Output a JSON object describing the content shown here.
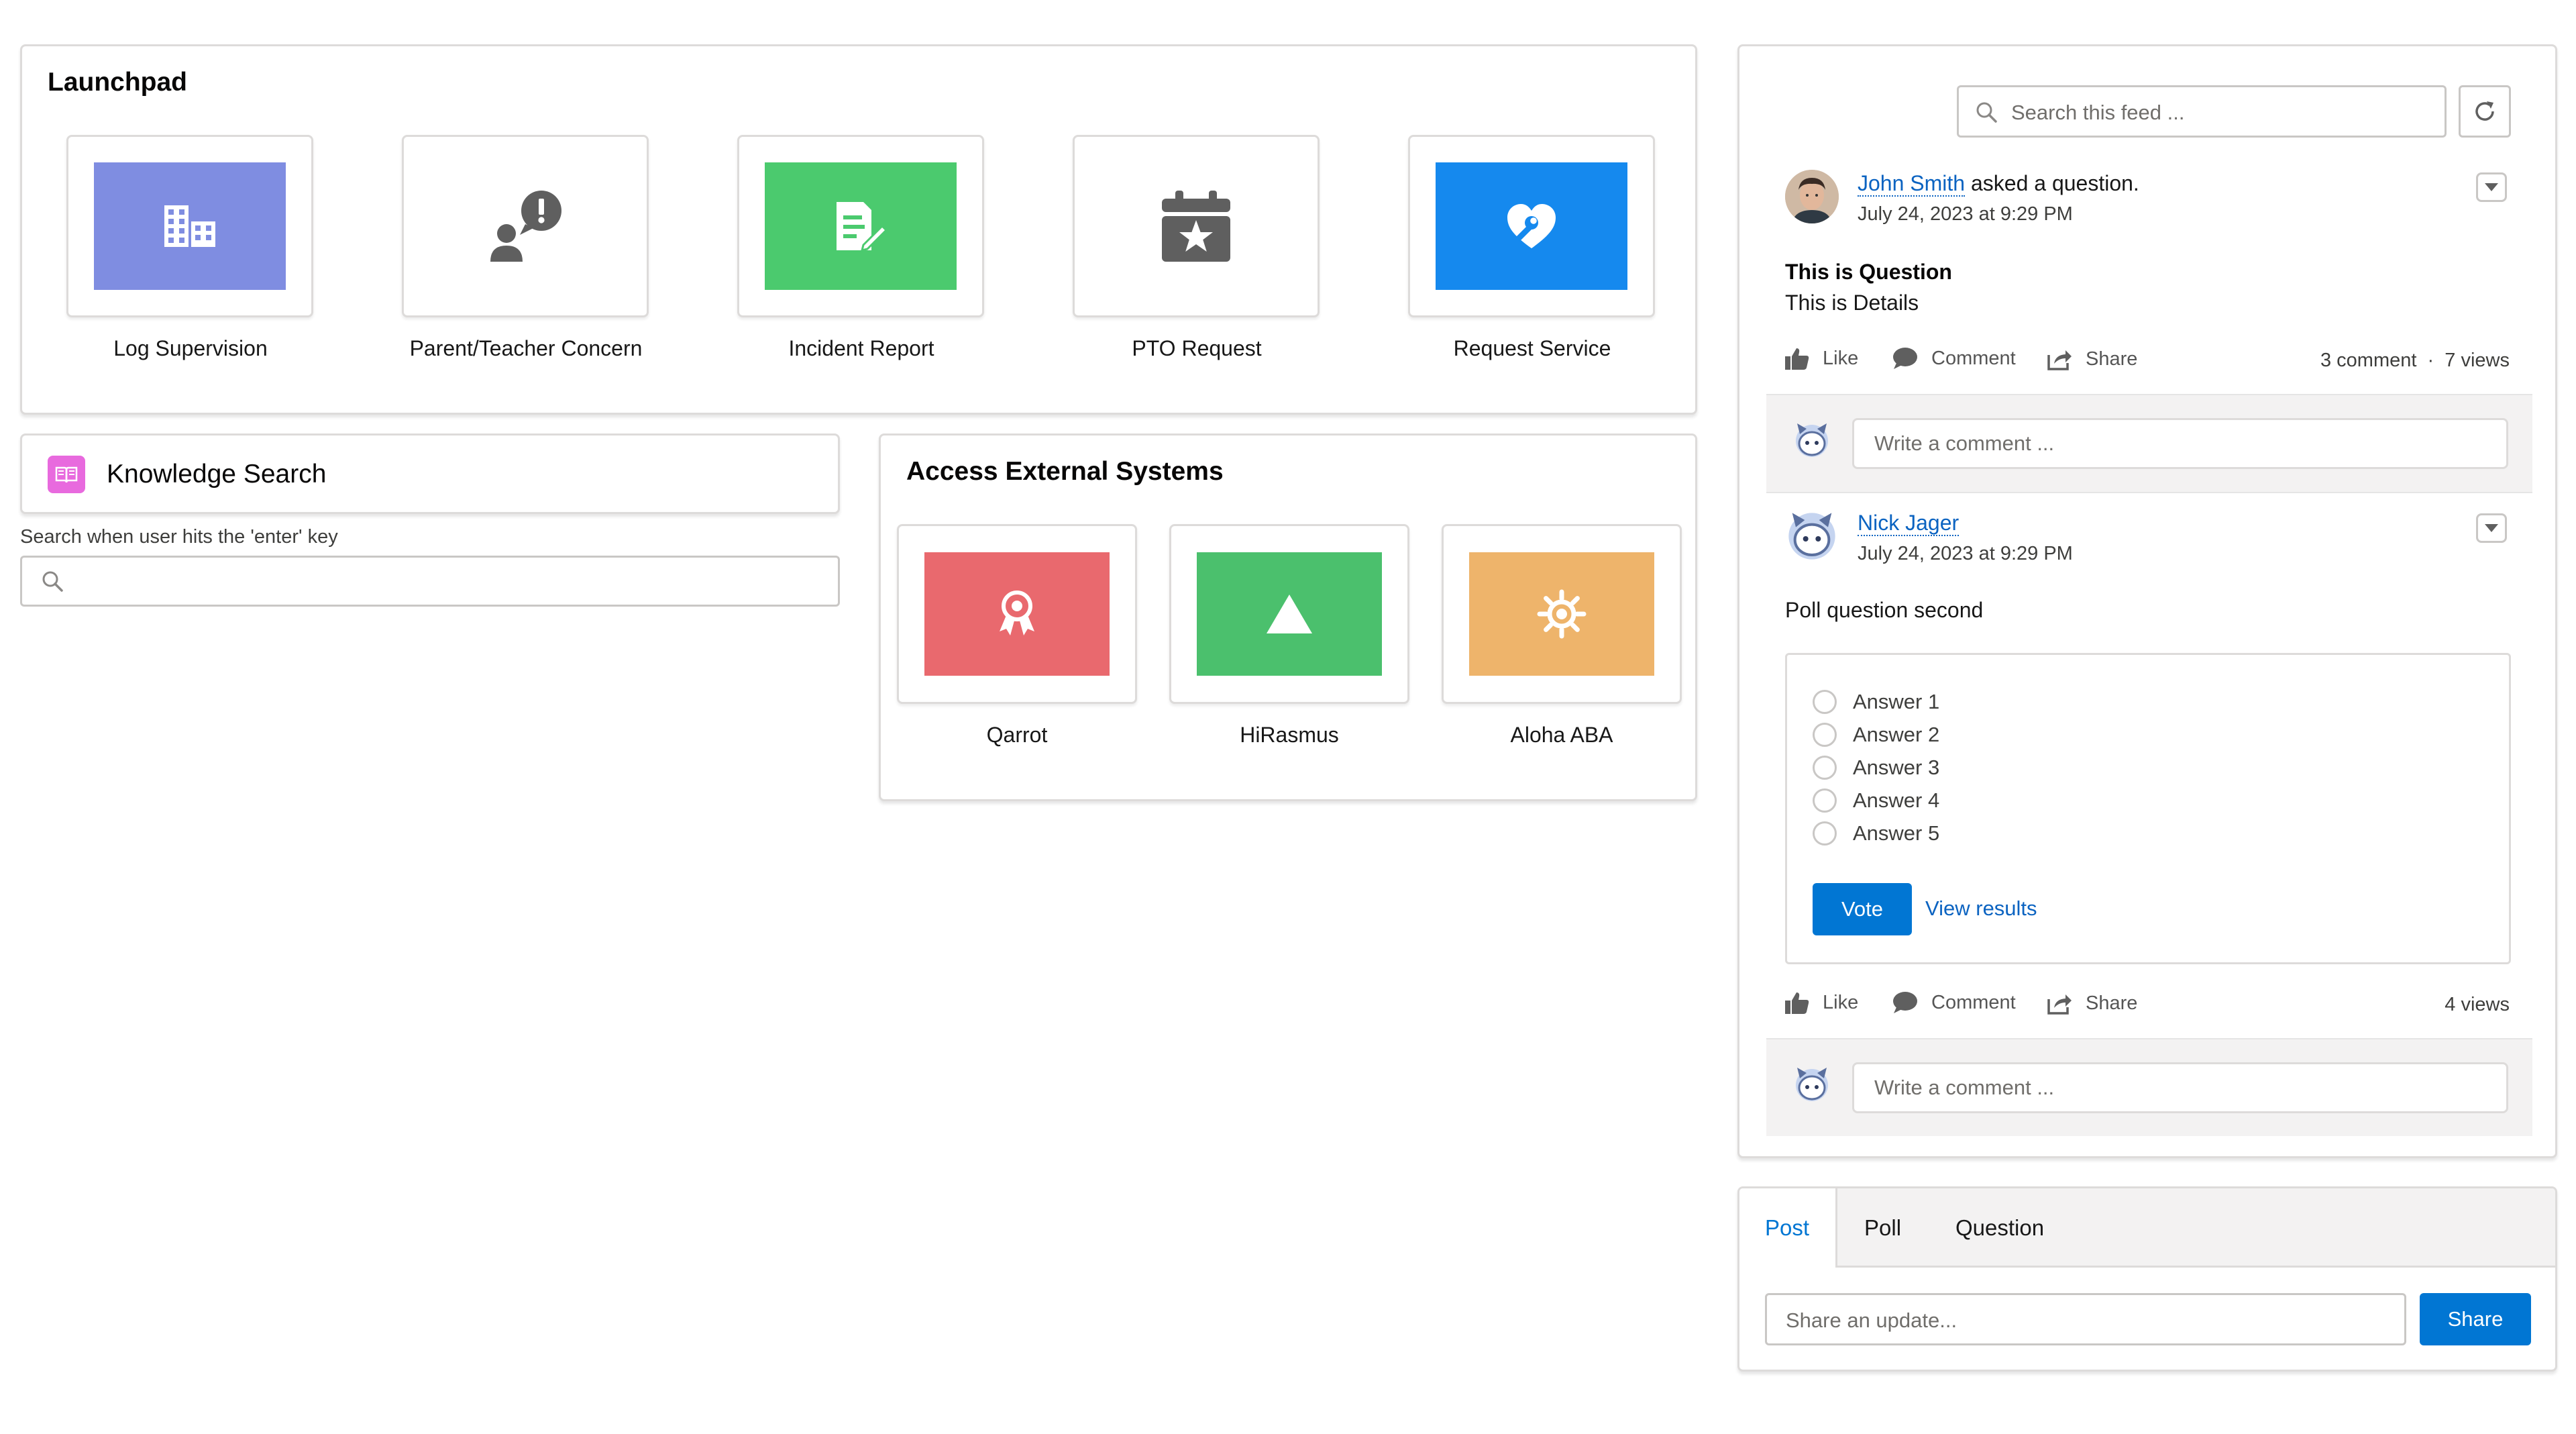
{
  "launchpad": {
    "title": "Launchpad",
    "tiles": [
      {
        "label": "Log Supervision",
        "icon": "building-icon",
        "color": "#7f8de1"
      },
      {
        "label": "Parent/Teacher Concern",
        "icon": "user-alert-icon",
        "color": "#ffffff"
      },
      {
        "label": "Incident Report",
        "icon": "document-edit-icon",
        "color": "#4bca6e"
      },
      {
        "label": "PTO Request",
        "icon": "calendar-star-icon",
        "color": "#ffffff"
      },
      {
        "label": "Request Service",
        "icon": "heart-wrench-icon",
        "color": "#1589ee"
      }
    ]
  },
  "knowledge": {
    "title": "Knowledge Search",
    "hint": "Search when user hits the 'enter' key",
    "search_placeholder": ""
  },
  "external": {
    "title": "Access External Systems",
    "tiles": [
      {
        "label": "Qarrot",
        "icon": "award-icon",
        "color": "#e9696e"
      },
      {
        "label": "HiRasmus",
        "icon": "triangle-icon",
        "color": "#4bc06d"
      },
      {
        "label": "Aloha ABA",
        "icon": "sun-gear-icon",
        "color": "#eeb46b"
      }
    ]
  },
  "feed": {
    "search_placeholder": "Search this feed ...",
    "posts": [
      {
        "author": "John Smith",
        "action": "asked a question.",
        "timestamp": "July 24, 2023 at 9:29 PM",
        "title": "This is Question",
        "details": "This is Details",
        "like": "Like",
        "comment": "Comment",
        "share": "Share",
        "stats": "3 comment  ·  7 views",
        "comment_placeholder": "Write a comment ..."
      },
      {
        "author": "Nick Jager",
        "timestamp": "July 24, 2023 at 9:29 PM",
        "body": "Poll question second",
        "answers": [
          "Answer 1",
          "Answer 2",
          "Answer 3",
          "Answer 4",
          "Answer 5"
        ],
        "vote": "Vote",
        "view_results": "View results",
        "like": "Like",
        "comment": "Comment",
        "share": "Share",
        "stats": "4 views",
        "comment_placeholder": "Write a comment ..."
      }
    ]
  },
  "publisher": {
    "tabs": [
      "Post",
      "Poll",
      "Question"
    ],
    "active_tab": "Post",
    "placeholder": "Share an update...",
    "share_label": "Share"
  },
  "colors": {
    "brand": "#0176d3",
    "link": "#0b63c1",
    "border": "#dddbda"
  }
}
